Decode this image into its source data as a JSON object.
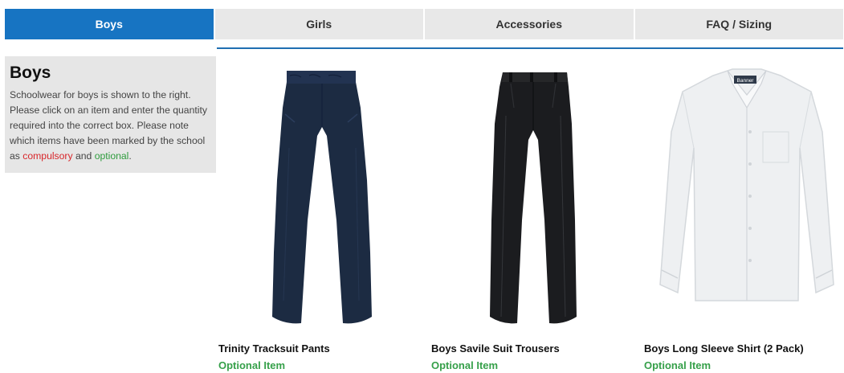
{
  "tabs": [
    {
      "label": "Boys",
      "active": true
    },
    {
      "label": "Girls",
      "active": false
    },
    {
      "label": "Accessories",
      "active": false
    },
    {
      "label": "FAQ / Sizing",
      "active": false
    }
  ],
  "info": {
    "title": "Boys",
    "text_before": "Schoolwear for boys is shown to the right. Please click on an item and enter the quantity required into the correct box. Please note which items have been marked by the school as ",
    "compulsory": "compulsory",
    "middle": " and ",
    "optional": "optional",
    "end": "."
  },
  "products": [
    {
      "name": "Trinity Tracksuit Pants",
      "status": "Optional Item",
      "icon": "tracksuit-pants-image"
    },
    {
      "name": "Boys Savile Suit Trousers",
      "status": "Optional Item",
      "icon": "suit-trousers-image"
    },
    {
      "name": "Boys Long Sleeve Shirt (2 Pack)",
      "status": "Optional Item",
      "icon": "long-sleeve-shirt-image"
    }
  ],
  "shirt_label": "Banner",
  "colors": {
    "active_tab": "#1774c2",
    "tab_bg": "#e8e8e8",
    "compulsory": "#d8262a",
    "optional": "#2e9c3d",
    "navy": "#1c2b42",
    "black": "#1b1c1f",
    "shirt": "#eef0f2"
  }
}
